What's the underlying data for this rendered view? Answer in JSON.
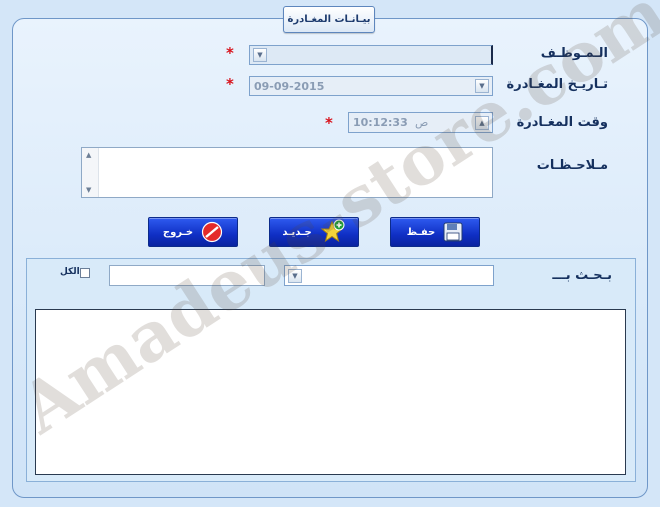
{
  "form": {
    "title": "بيـانـات المغـادرة",
    "employee_label": "الـمـوظـف",
    "date_label": "تـاريـخ المغـادرة",
    "date_value": "09-09-2015",
    "time_label": "وقت المغـادرة",
    "time_value": "10:12:33",
    "time_ampm": "ص",
    "notes_label": "مـلاحـظـات",
    "required_mark": "*"
  },
  "buttons": {
    "save": "حفـظ",
    "new": "جـديـد",
    "exit": "خـروج"
  },
  "search": {
    "label": "بـحـث بـــ",
    "all_label": "الكل"
  },
  "watermark": "Amadeus-store.com",
  "colors": {
    "background": "#d4e6f8",
    "button_blue": "#0f2fc4",
    "required_red": "#d8121b"
  }
}
